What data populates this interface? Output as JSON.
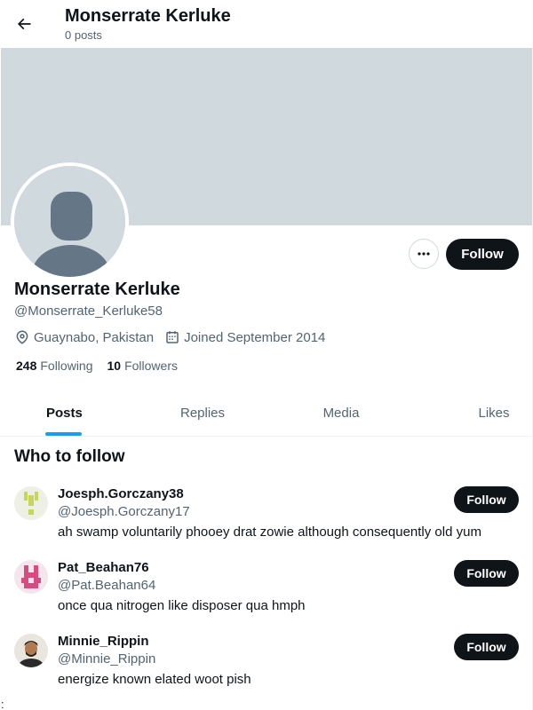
{
  "header": {
    "title": "Monserrate Kerluke",
    "posts_count": "0 posts"
  },
  "profile": {
    "name": "Monserrate Kerluke",
    "handle": "@Monserrate_Kerluke58",
    "location": "Guaynabo, Pakistan",
    "joined": "Joined September 2014",
    "following_count": "248",
    "following_label": "Following",
    "followers_count": "10",
    "followers_label": "Followers",
    "follow_label": "Follow",
    "more_label": "More"
  },
  "tabs": [
    {
      "label": "Posts",
      "active": true
    },
    {
      "label": "Replies",
      "active": false
    },
    {
      "label": "Media",
      "active": false
    },
    {
      "label": "Likes",
      "active": false
    }
  ],
  "who_to_follow": {
    "title": "Who to follow",
    "suggestions": [
      {
        "name": "Joesph.Gorczany38",
        "handle": "@Joesph.Gorczany17",
        "bio": "ah swamp voluntarily phooey drat zowie although consequently old yum",
        "follow_label": "Follow"
      },
      {
        "name": "Pat_Beahan76",
        "handle": "@Pat.Beahan64",
        "bio": "once qua nitrogen like disposer qua hmph",
        "follow_label": "Follow"
      },
      {
        "name": "Minnie_Rippin",
        "handle": "@Minnie_Rippin",
        "bio": "energize known elated woot pish",
        "follow_label": "Follow"
      }
    ]
  },
  "stray_char": ":",
  "colors": {
    "accent": "#1d9bf0",
    "banner": "#cfd9de",
    "button_dark": "#0f1419",
    "muted_text": "#536471"
  }
}
